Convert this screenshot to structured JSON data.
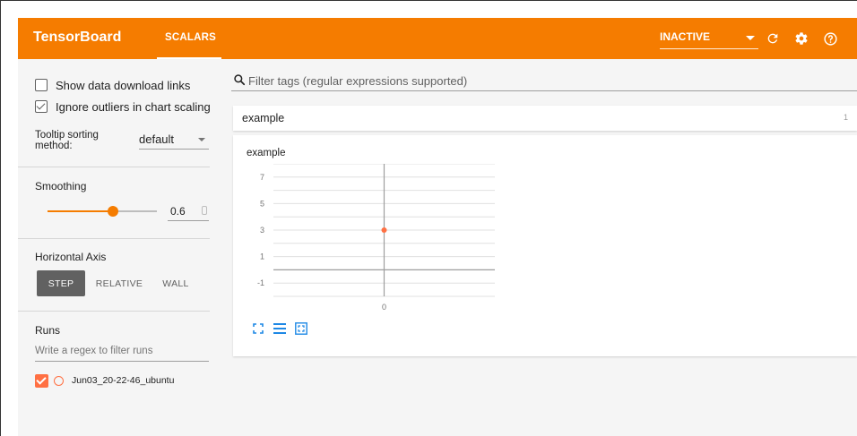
{
  "toolbar": {
    "brand": "TensorBoard",
    "tab_scalars": "SCALARS",
    "status_value": "INACTIVE",
    "color": "#f57c00"
  },
  "sidebar": {
    "show_download_label": "Show data download links",
    "show_download_checked": false,
    "ignore_outliers_label": "Ignore outliers in chart scaling",
    "ignore_outliers_checked": true,
    "tooltip_sort_label": "Tooltip sorting method:",
    "tooltip_sort_value": "default",
    "smoothing_title": "Smoothing",
    "smoothing_value": "0.6",
    "smoothing_level": 0.6,
    "horizontal_axis_title": "Horizontal Axis",
    "axis_options": [
      "STEP",
      "RELATIVE",
      "WALL"
    ],
    "axis_selected": "STEP",
    "runs_title": "Runs",
    "runs_filter_placeholder": "Write a regex to filter runs",
    "runs": [
      {
        "name": "Jun03_20-22-46_ubuntu",
        "checked": true,
        "color": "#ff7043"
      }
    ]
  },
  "main": {
    "filter_placeholder": "Filter tags (regular expressions supported)",
    "card_title": "example",
    "card_count": "1"
  },
  "chart_data": {
    "type": "scatter",
    "title": "example",
    "x_ticks": [
      "0"
    ],
    "y_ticks": [
      "-1",
      "1",
      "3",
      "5",
      "7"
    ],
    "xlim": [
      -1,
      1
    ],
    "ylim": [
      -2,
      8
    ],
    "grid": true,
    "series": [
      {
        "x": [
          0
        ],
        "values": [
          3
        ],
        "color": "#ff7043"
      }
    ]
  },
  "icons": {
    "refresh": "refresh-icon",
    "settings": "gear-icon",
    "help": "help-icon",
    "search": "search-icon",
    "fit": "fit-domain-icon",
    "log": "log-scale-icon",
    "expand": "expand-icon"
  }
}
